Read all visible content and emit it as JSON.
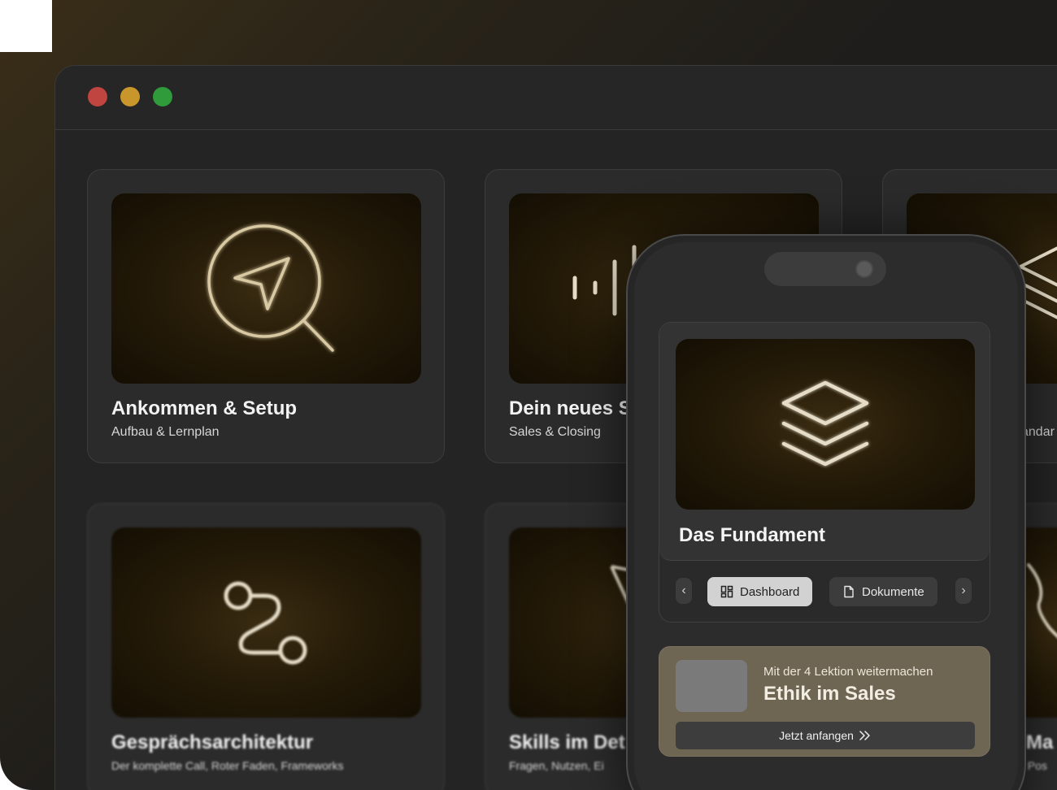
{
  "window": {
    "controls": [
      "close",
      "minimize",
      "maximize"
    ]
  },
  "modules": [
    {
      "title": "Ankommen & Setup",
      "subtitle": "Aufbau & Lernplan",
      "icon": "navigation-search-icon"
    },
    {
      "title": "Dein neues S",
      "subtitle": "Sales & Closing",
      "icon": "soundwave-icon"
    },
    {
      "title": "",
      "subtitle": "andar",
      "icon": "layers-icon"
    },
    {
      "title": "Gesprächsarchitektur",
      "subtitle": "Der komplette Call, Roter Faden, Frameworks",
      "icon": "route-icon"
    },
    {
      "title": "Skills im Det",
      "subtitle": "Fragen, Nutzen, Ei",
      "icon": "cursor-icon"
    },
    {
      "title": "Ma",
      "subtitle": ", Pos",
      "icon": "phone-icon"
    }
  ],
  "phone": {
    "module_title": "Das Fundament",
    "module_icon": "layers-icon",
    "prev_label": "‹",
    "next_label": "›",
    "tabs": [
      {
        "label": "Dashboard",
        "icon": "dashboard-icon",
        "active": true
      },
      {
        "label": "Dokumente",
        "icon": "document-icon",
        "active": false
      }
    ],
    "continue": {
      "pretext": "Mit der 4 Lektion weitermachen",
      "lesson": "Ethik im Sales",
      "button": "Jetzt anfangen",
      "button_icon": "double-chevron-right-icon"
    }
  },
  "colors": {
    "accent_gold": "#d9c9a3",
    "thumb_center": "#3a2c12",
    "continue_bg": "#6f6553"
  }
}
